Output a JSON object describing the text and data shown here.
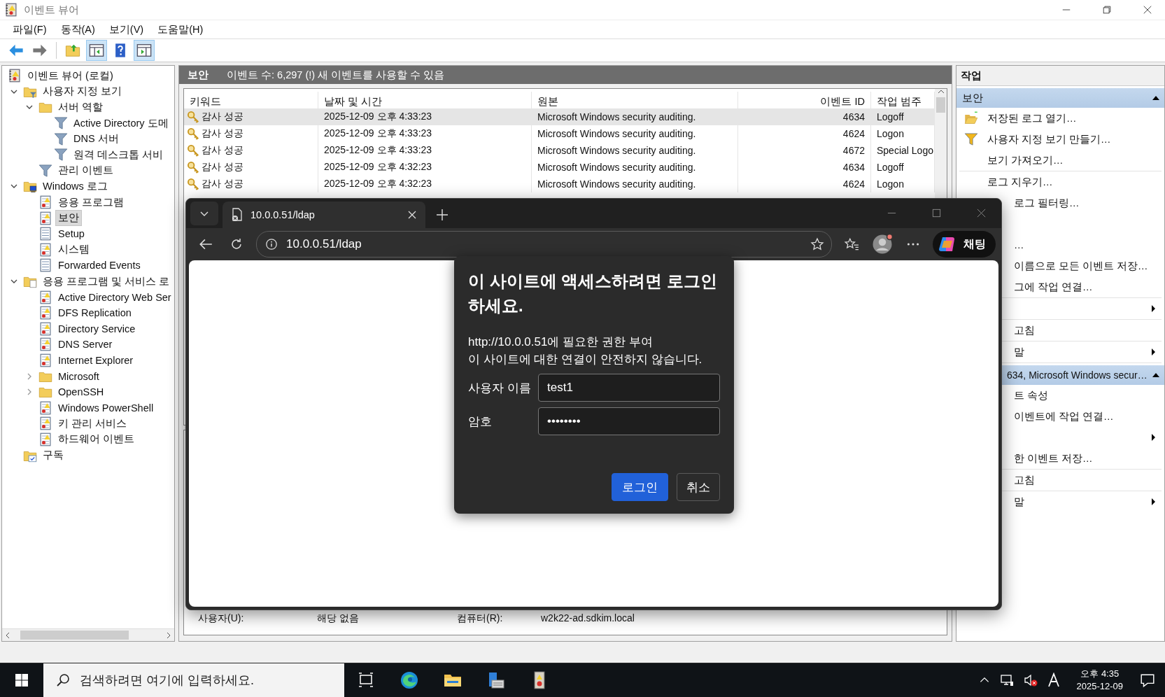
{
  "window": {
    "title": "이벤트 뷰어"
  },
  "menu": [
    "파일(F)",
    "동작(A)",
    "보기(V)",
    "도움말(H)"
  ],
  "tree": [
    {
      "label": "이벤트 뷰어 (로컬)",
      "kind": "console",
      "selected": false,
      "children": [
        {
          "label": "사용자 지정 보기",
          "kind": "custom-views",
          "selected": false,
          "expanded": true,
          "children": [
            {
              "label": "서버 역할",
              "kind": "folder",
              "selected": false,
              "expanded": true,
              "children": [
                {
                  "label": "Active Directory 도메",
                  "kind": "filter",
                  "selected": false
                },
                {
                  "label": "DNS 서버",
                  "kind": "filter",
                  "selected": false
                },
                {
                  "label": "원격 데스크톱 서비",
                  "kind": "filter",
                  "selected": false
                }
              ]
            },
            {
              "label": "관리 이벤트",
              "kind": "filter",
              "selected": false
            }
          ]
        },
        {
          "label": "Windows 로그",
          "kind": "windows-logs",
          "selected": false,
          "expanded": true,
          "children": [
            {
              "label": "응용 프로그램",
              "kind": "log",
              "selected": false
            },
            {
              "label": "보안",
              "kind": "log",
              "selected": true
            },
            {
              "label": "Setup",
              "kind": "log-plain",
              "selected": false
            },
            {
              "label": "시스템",
              "kind": "log",
              "selected": false
            },
            {
              "label": "Forwarded Events",
              "kind": "log-plain",
              "selected": false
            }
          ]
        },
        {
          "label": "응용 프로그램 및 서비스 로",
          "kind": "app-logs",
          "selected": false,
          "expanded": true,
          "children": [
            {
              "label": "Active Directory Web Ser",
              "kind": "log",
              "selected": false
            },
            {
              "label": "DFS Replication",
              "kind": "log",
              "selected": false
            },
            {
              "label": "Directory Service",
              "kind": "log",
              "selected": false
            },
            {
              "label": "DNS Server",
              "kind": "log",
              "selected": false
            },
            {
              "label": "Internet Explorer",
              "kind": "log",
              "selected": false
            },
            {
              "label": "Microsoft",
              "kind": "folder",
              "selected": false,
              "expanded": false
            },
            {
              "label": "OpenSSH",
              "kind": "folder",
              "selected": false,
              "expanded": false
            },
            {
              "label": "Windows PowerShell",
              "kind": "log",
              "selected": false
            },
            {
              "label": "키 관리 서비스",
              "kind": "log",
              "selected": false
            },
            {
              "label": "하드웨어 이벤트",
              "kind": "log",
              "selected": false
            }
          ]
        },
        {
          "label": "구독",
          "kind": "subscriptions",
          "selected": false
        }
      ]
    }
  ],
  "events": {
    "title": "보안",
    "summary": "이벤트 수: 6,297 (!) 새 이벤트를 사용할 수 있음",
    "columns": [
      "키워드",
      "날짜 및 시간",
      "원본",
      "이벤트 ID",
      "작업 범주"
    ],
    "rows": [
      {
        "keyword": "감사 성공",
        "date": "2025-12-09 오후 4:33:23",
        "source": "Microsoft Windows security auditing.",
        "id": "4634",
        "category": "Logoff",
        "selected": true
      },
      {
        "keyword": "감사 성공",
        "date": "2025-12-09 오후 4:33:23",
        "source": "Microsoft Windows security auditing.",
        "id": "4624",
        "category": "Logon",
        "selected": false
      },
      {
        "keyword": "감사 성공",
        "date": "2025-12-09 오후 4:33:23",
        "source": "Microsoft Windows security auditing.",
        "id": "4672",
        "category": "Special Logo",
        "selected": false
      },
      {
        "keyword": "감사 성공",
        "date": "2025-12-09 오후 4:32:23",
        "source": "Microsoft Windows security auditing.",
        "id": "4634",
        "category": "Logoff",
        "selected": false
      },
      {
        "keyword": "감사 성공",
        "date": "2025-12-09 오후 4:32:23",
        "source": "Microsoft Windows security auditing.",
        "id": "4624",
        "category": "Logon",
        "selected": false
      }
    ],
    "preview": [
      {
        "label": "사용자(U):",
        "value": "해당 없음"
      },
      {
        "label": "컴퓨터(R):",
        "value": "w2k22-ad.sdkim.local"
      }
    ]
  },
  "actions": {
    "title": "작업",
    "sections": [
      {
        "title": "보안",
        "expanded": true,
        "groups": [
          [
            {
              "label": "저장된 로그 열기…",
              "kind": "open-folder",
              "submenu": false
            },
            {
              "label": "사용자 지정 보기 만들기…",
              "kind": "filter-add",
              "submenu": false
            },
            {
              "label": "보기 가져오기…",
              "submenu": false
            }
          ],
          [
            {
              "label": "로그 지우기…",
              "submenu": false
            },
            {
              "label": "로그 필터링…",
              "submenu": false
            },
            {
              "label": "…",
              "submenu": false
            },
            {
              "label": "이름으로 모든 이벤트 저장…",
              "submenu": false
            },
            {
              "label": "그에 작업 연결…",
              "submenu": false
            }
          ],
          [
            {
              "submenu": true
            }
          ],
          [
            {
              "label": "고침",
              "submenu": false
            }
          ],
          [
            {
              "label": "말",
              "submenu": true
            }
          ]
        ]
      },
      {
        "title": "634, Microsoft Windows secur…",
        "expanded": true,
        "groups": [
          [
            {
              "label": "트 속성",
              "submenu": false
            },
            {
              "label": "이벤트에 작업 연결…",
              "submenu": false
            },
            {
              "submenu": true
            },
            {
              "label": "한 이벤트 저장…",
              "submenu": false
            }
          ],
          [
            {
              "label": "고침",
              "submenu": false
            }
          ],
          [
            {
              "label": "말",
              "submenu": true
            }
          ]
        ]
      }
    ]
  },
  "browser": {
    "tab": {
      "title": "10.0.0.51/ldap"
    },
    "address": "10.0.0.51/ldap",
    "chat": "채팅",
    "dialog": {
      "title": "이 사이트에 액세스하려면 로그인 하세요.",
      "lines": [
        "http://10.0.0.51에 필요한 권한 부여",
        "이 사이트에 대한 연결이 안전하지 않습니다."
      ],
      "fields": [
        {
          "label": "사용자 이름",
          "value": "test1"
        },
        {
          "label": "암호",
          "value": "••••••••"
        }
      ],
      "buttons": [
        {
          "label": "로그인",
          "primary": true
        },
        {
          "label": "취소",
          "primary": false
        }
      ]
    }
  },
  "taskbar": {
    "search_placeholder": "검색하려면 여기에 입력하세요.",
    "time": "오후 4:35",
    "date": "2025-12-09"
  }
}
